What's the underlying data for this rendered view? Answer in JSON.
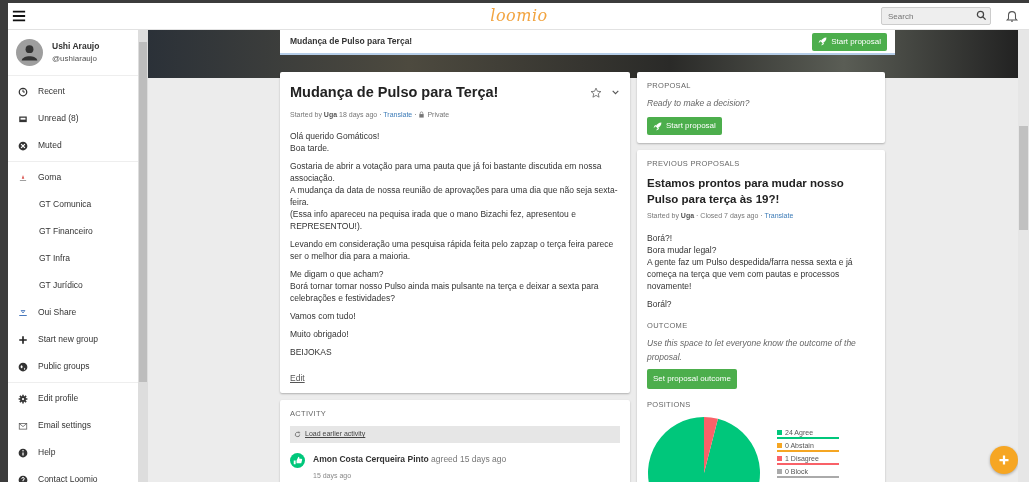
{
  "navbar": {
    "logo": "loomio",
    "search": {
      "placeholder": "Search"
    }
  },
  "sidebar": {
    "user": {
      "name": "Ushi Araujo",
      "handle": "@ushiaraujo"
    },
    "sections": [
      {
        "items": [
          {
            "label": "Recent"
          },
          {
            "label": "Unread (8)"
          },
          {
            "label": "Muted"
          }
        ]
      },
      {
        "items": [
          {
            "label": "Goma",
            "children": [
              {
                "label": "GT Comunica"
              },
              {
                "label": "GT Financeiro"
              },
              {
                "label": "GT Infra"
              },
              {
                "label": "GT Jurídico"
              }
            ]
          },
          {
            "label": "Oui Share"
          },
          {
            "label": "Start new group"
          },
          {
            "label": "Public groups"
          }
        ]
      },
      {
        "items": [
          {
            "label": "Edit profile"
          },
          {
            "label": "Email settings"
          },
          {
            "label": "Help"
          },
          {
            "label": "Contact Loomio"
          }
        ]
      }
    ]
  },
  "sticky_bar": {
    "title": "Mudança de Pulso para Terça!",
    "button": "Start proposal"
  },
  "thread": {
    "title": "Mudança de Pulso para Terça!",
    "starred": false,
    "meta": {
      "prefix": "Started by",
      "author": "Uga",
      "time": "18 days ago",
      "separator": "·",
      "translate": "Translate",
      "privacy": "Private"
    },
    "paragraphs": [
      [
        "Olá querido Gomáticos!",
        "Boa tarde."
      ],
      [
        "Gostaria de abrir a votação para uma pauta que já foi bastante discutida em nossa associação.",
        "A mudança da data de nossa reunião de aprovações para uma dia que não seja sexta-feira.",
        "(Essa info apareceu na pequisa irada que o mano Bizachi fez, apresentou e REPRESENTOU!)."
      ],
      [
        "Levando em consideração uma pesquisa rápida feita pelo zapzap o terça feira parece ser o melhor dia para a maioria."
      ],
      [
        "Me digam o que acham?",
        "Borá tornar tornar nosso Pulso ainda mais pulsante na terça e deixar a sexta para celebrações e festividades?"
      ],
      [
        "Vamos com tudo!"
      ],
      [
        "Muito obrigado!"
      ],
      [
        "BEIJOKAS"
      ]
    ],
    "edit": "Edit"
  },
  "activity": {
    "heading": "ACTIVITY",
    "load_earlier": "Load earlier activity",
    "items": [
      {
        "author": "Amon Costa Cerqueira Pinto",
        "action": "agreed 15 days ago",
        "time": "15 days ago"
      }
    ]
  },
  "proposal": {
    "heading": "PROPOSAL",
    "prompt": "Ready to make a decision?",
    "button": "Start proposal"
  },
  "previous_proposals": {
    "heading": "PREVIOUS PROPOSALS",
    "title": "Estamos prontos para mudar nosso Pulso para terça às 19?!",
    "meta": {
      "prefix": "Started by",
      "author": "Uga",
      "separator": "·",
      "closed": "Closed 7 days ago",
      "translate": "Translate"
    },
    "paragraphs": [
      [
        "Borá?!",
        "Bora mudar legal?",
        "A gente faz um Pulso despedida/farra nessa sexta e já começa na terça que vem com pautas e processos novamente!"
      ],
      [
        "Borál?"
      ]
    ],
    "outcome": {
      "heading": "OUTCOME",
      "hint": "Use this space to let everyone know the outcome of the proposal.",
      "button": "Set proposal outcome"
    },
    "positions": {
      "chart_data": {
        "type": "pie",
        "title": "POSITIONS",
        "categories": [
          "24 Agree",
          "0 Abstain",
          "1 Disagree",
          "0 Block"
        ],
        "colors": [
          "#00c77b",
          "#f5a623",
          "#f96168",
          "#aaaaaa"
        ],
        "series": [
          {
            "values": [
              24,
              0,
              1,
              0
            ]
          }
        ],
        "legend": "right"
      }
    }
  }
}
